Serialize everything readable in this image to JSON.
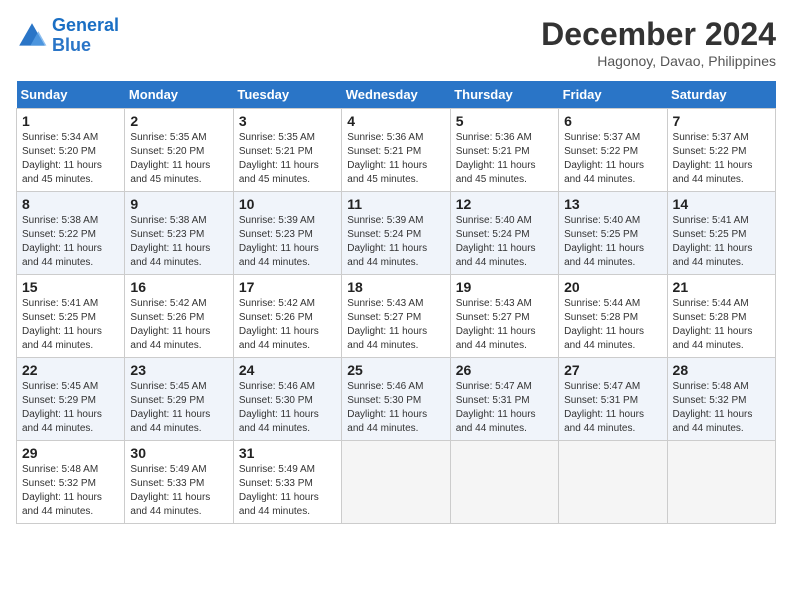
{
  "logo": {
    "line1": "General",
    "line2": "Blue"
  },
  "title": "December 2024",
  "subtitle": "Hagonoy, Davao, Philippines",
  "days_of_week": [
    "Sunday",
    "Monday",
    "Tuesday",
    "Wednesday",
    "Thursday",
    "Friday",
    "Saturday"
  ],
  "weeks": [
    [
      {
        "num": "1",
        "sunrise": "5:34 AM",
        "sunset": "5:20 PM",
        "daylight": "11 hours and 45 minutes."
      },
      {
        "num": "2",
        "sunrise": "5:35 AM",
        "sunset": "5:20 PM",
        "daylight": "11 hours and 45 minutes."
      },
      {
        "num": "3",
        "sunrise": "5:35 AM",
        "sunset": "5:21 PM",
        "daylight": "11 hours and 45 minutes."
      },
      {
        "num": "4",
        "sunrise": "5:36 AM",
        "sunset": "5:21 PM",
        "daylight": "11 hours and 45 minutes."
      },
      {
        "num": "5",
        "sunrise": "5:36 AM",
        "sunset": "5:21 PM",
        "daylight": "11 hours and 45 minutes."
      },
      {
        "num": "6",
        "sunrise": "5:37 AM",
        "sunset": "5:22 PM",
        "daylight": "11 hours and 44 minutes."
      },
      {
        "num": "7",
        "sunrise": "5:37 AM",
        "sunset": "5:22 PM",
        "daylight": "11 hours and 44 minutes."
      }
    ],
    [
      {
        "num": "8",
        "sunrise": "5:38 AM",
        "sunset": "5:22 PM",
        "daylight": "11 hours and 44 minutes."
      },
      {
        "num": "9",
        "sunrise": "5:38 AM",
        "sunset": "5:23 PM",
        "daylight": "11 hours and 44 minutes."
      },
      {
        "num": "10",
        "sunrise": "5:39 AM",
        "sunset": "5:23 PM",
        "daylight": "11 hours and 44 minutes."
      },
      {
        "num": "11",
        "sunrise": "5:39 AM",
        "sunset": "5:24 PM",
        "daylight": "11 hours and 44 minutes."
      },
      {
        "num": "12",
        "sunrise": "5:40 AM",
        "sunset": "5:24 PM",
        "daylight": "11 hours and 44 minutes."
      },
      {
        "num": "13",
        "sunrise": "5:40 AM",
        "sunset": "5:25 PM",
        "daylight": "11 hours and 44 minutes."
      },
      {
        "num": "14",
        "sunrise": "5:41 AM",
        "sunset": "5:25 PM",
        "daylight": "11 hours and 44 minutes."
      }
    ],
    [
      {
        "num": "15",
        "sunrise": "5:41 AM",
        "sunset": "5:25 PM",
        "daylight": "11 hours and 44 minutes."
      },
      {
        "num": "16",
        "sunrise": "5:42 AM",
        "sunset": "5:26 PM",
        "daylight": "11 hours and 44 minutes."
      },
      {
        "num": "17",
        "sunrise": "5:42 AM",
        "sunset": "5:26 PM",
        "daylight": "11 hours and 44 minutes."
      },
      {
        "num": "18",
        "sunrise": "5:43 AM",
        "sunset": "5:27 PM",
        "daylight": "11 hours and 44 minutes."
      },
      {
        "num": "19",
        "sunrise": "5:43 AM",
        "sunset": "5:27 PM",
        "daylight": "11 hours and 44 minutes."
      },
      {
        "num": "20",
        "sunrise": "5:44 AM",
        "sunset": "5:28 PM",
        "daylight": "11 hours and 44 minutes."
      },
      {
        "num": "21",
        "sunrise": "5:44 AM",
        "sunset": "5:28 PM",
        "daylight": "11 hours and 44 minutes."
      }
    ],
    [
      {
        "num": "22",
        "sunrise": "5:45 AM",
        "sunset": "5:29 PM",
        "daylight": "11 hours and 44 minutes."
      },
      {
        "num": "23",
        "sunrise": "5:45 AM",
        "sunset": "5:29 PM",
        "daylight": "11 hours and 44 minutes."
      },
      {
        "num": "24",
        "sunrise": "5:46 AM",
        "sunset": "5:30 PM",
        "daylight": "11 hours and 44 minutes."
      },
      {
        "num": "25",
        "sunrise": "5:46 AM",
        "sunset": "5:30 PM",
        "daylight": "11 hours and 44 minutes."
      },
      {
        "num": "26",
        "sunrise": "5:47 AM",
        "sunset": "5:31 PM",
        "daylight": "11 hours and 44 minutes."
      },
      {
        "num": "27",
        "sunrise": "5:47 AM",
        "sunset": "5:31 PM",
        "daylight": "11 hours and 44 minutes."
      },
      {
        "num": "28",
        "sunrise": "5:48 AM",
        "sunset": "5:32 PM",
        "daylight": "11 hours and 44 minutes."
      }
    ],
    [
      {
        "num": "29",
        "sunrise": "5:48 AM",
        "sunset": "5:32 PM",
        "daylight": "11 hours and 44 minutes."
      },
      {
        "num": "30",
        "sunrise": "5:49 AM",
        "sunset": "5:33 PM",
        "daylight": "11 hours and 44 minutes."
      },
      {
        "num": "31",
        "sunrise": "5:49 AM",
        "sunset": "5:33 PM",
        "daylight": "11 hours and 44 minutes."
      },
      null,
      null,
      null,
      null
    ]
  ]
}
